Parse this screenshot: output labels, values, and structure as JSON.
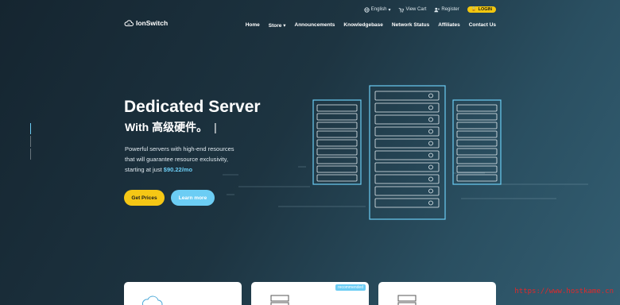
{
  "topbar": {
    "language": "English",
    "view_cart": "View Cart",
    "register": "Register",
    "login": "LOGIN"
  },
  "logo": {
    "text": "IonSwitch"
  },
  "nav": [
    "Home",
    "Store",
    "Announcements",
    "Knowledgebase",
    "Network Status",
    "Affiliates",
    "Contact Us"
  ],
  "hero": {
    "title": "Dedicated Server",
    "subtitle": "With 高级硬件。",
    "caret": "|",
    "desc_line1": "Powerful servers with high-end resources",
    "desc_line2": "that will guarantee resource exclusivity,",
    "desc_line3_prefix": "starting at just ",
    "price": "$90.22/mo",
    "btn_prices": "Get Prices",
    "btn_more": "Learn more"
  },
  "cards": {
    "badge": "recommended"
  },
  "watermark": "https://www.hostkame.cn",
  "colors": {
    "accent_yellow": "#f5c715",
    "accent_blue": "#6ccdf4",
    "bg_dark": "#152530"
  }
}
